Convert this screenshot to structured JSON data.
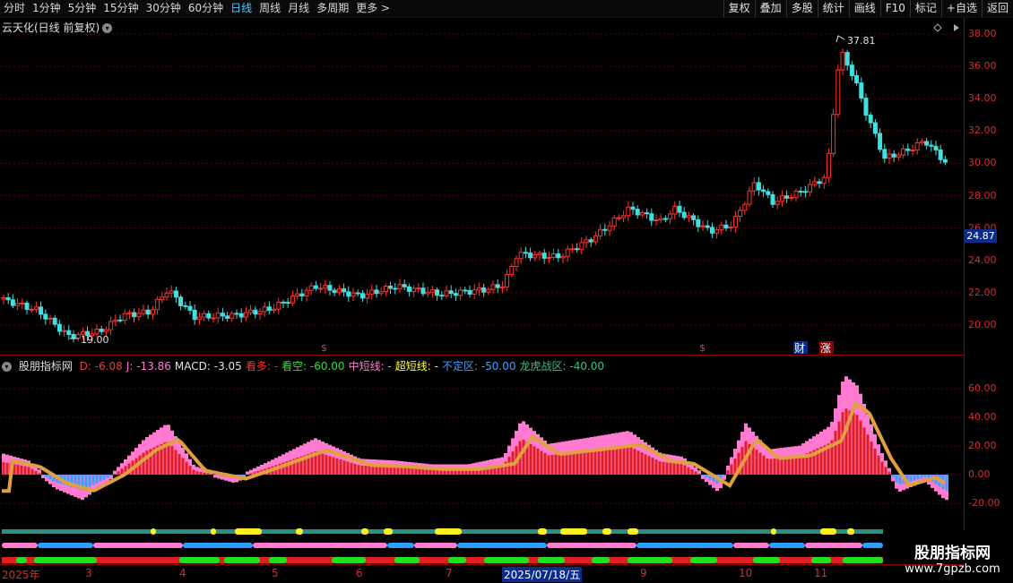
{
  "toolbar": {
    "left_items": [
      "分时",
      "1分钟",
      "5分钟",
      "15分钟",
      "30分钟",
      "60分钟",
      "日线",
      "周线",
      "月线",
      "多周期",
      "更多 >"
    ],
    "active_item": "日线",
    "right_items": [
      "复权",
      "叠加",
      "多股",
      "统计",
      "画线",
      "F10",
      "标记",
      "+自选",
      "返回"
    ]
  },
  "stock": {
    "title": "云天化(日线 前复权)"
  },
  "price_axis": {
    "ticks": [
      "38.00",
      "36.00",
      "34.00",
      "32.00",
      "30.00",
      "28.00",
      "26.00",
      "24.00",
      "22.00",
      "20.00"
    ],
    "current_price": "24.87"
  },
  "annotations": {
    "high": "37.81",
    "low": "19.00",
    "markers": [
      "$",
      "$",
      "财",
      "涨"
    ]
  },
  "indicator": {
    "name": "股朋指标网",
    "legend": [
      {
        "label": "D: -6.08",
        "color": "#e04040"
      },
      {
        "label": "J: -13.86",
        "color": "#ff7ad0"
      },
      {
        "label": "MACD: -3.05",
        "color": "#e0e0e0"
      },
      {
        "label": "看多: -",
        "color": "#ff3030"
      },
      {
        "label": "看空: -60.00",
        "color": "#30e030"
      },
      {
        "label": "中短线: -",
        "color": "#ff7ad0"
      },
      {
        "label": "超短线: -",
        "color": "#ffff40"
      },
      {
        "label": "不定区: -50.00",
        "color": "#40a0ff"
      },
      {
        "label": "龙虎战区: -40.00",
        "color": "#40c080"
      }
    ],
    "ticks": [
      "60.00",
      "40.00",
      "20.00",
      "0.00",
      "-20.00"
    ]
  },
  "date_axis": {
    "labels": [
      "2025年",
      "3",
      "4",
      "5",
      "6",
      "7",
      "9",
      "10",
      "11"
    ],
    "highlight": "2025/07/18/五"
  },
  "watermark": {
    "line1": "股朋指标网",
    "line2": "www.7gpzb.com"
  },
  "colors": {
    "up": "#ff3333",
    "down": "#40e0e0",
    "axis": "#d03030",
    "grid": "#5a0000"
  }
}
